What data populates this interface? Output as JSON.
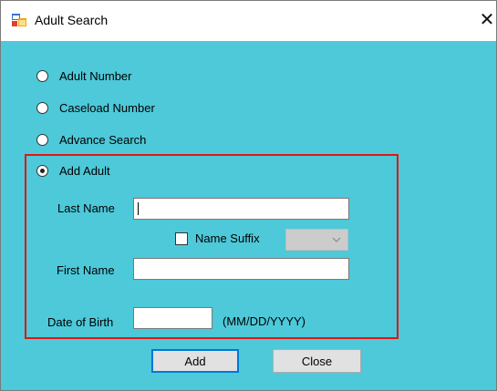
{
  "window": {
    "title": "Adult Search",
    "close_glyph": "✕",
    "icon": "app-window-icon",
    "background": "#4dc9d9"
  },
  "search_type": {
    "options": [
      {
        "label": "Adult Number",
        "checked": false
      },
      {
        "label": "Caseload Number",
        "checked": false
      },
      {
        "label": "Advance Search",
        "checked": false
      },
      {
        "label": "Add Adult",
        "checked": true
      }
    ]
  },
  "add_adult": {
    "highlight_color": "#e01515",
    "last_name_label": "Last Name",
    "last_name_value": "",
    "name_suffix_label": "Name Suffix",
    "name_suffix_checked": false,
    "suffix_select_value": "",
    "first_name_label": "First Name",
    "first_name_value": "",
    "dob_label": "Date of Birth",
    "dob_value": "",
    "dob_format_hint": "(MM/DD/YYYY)"
  },
  "buttons": {
    "add_label": "Add",
    "close_label": "Close"
  }
}
